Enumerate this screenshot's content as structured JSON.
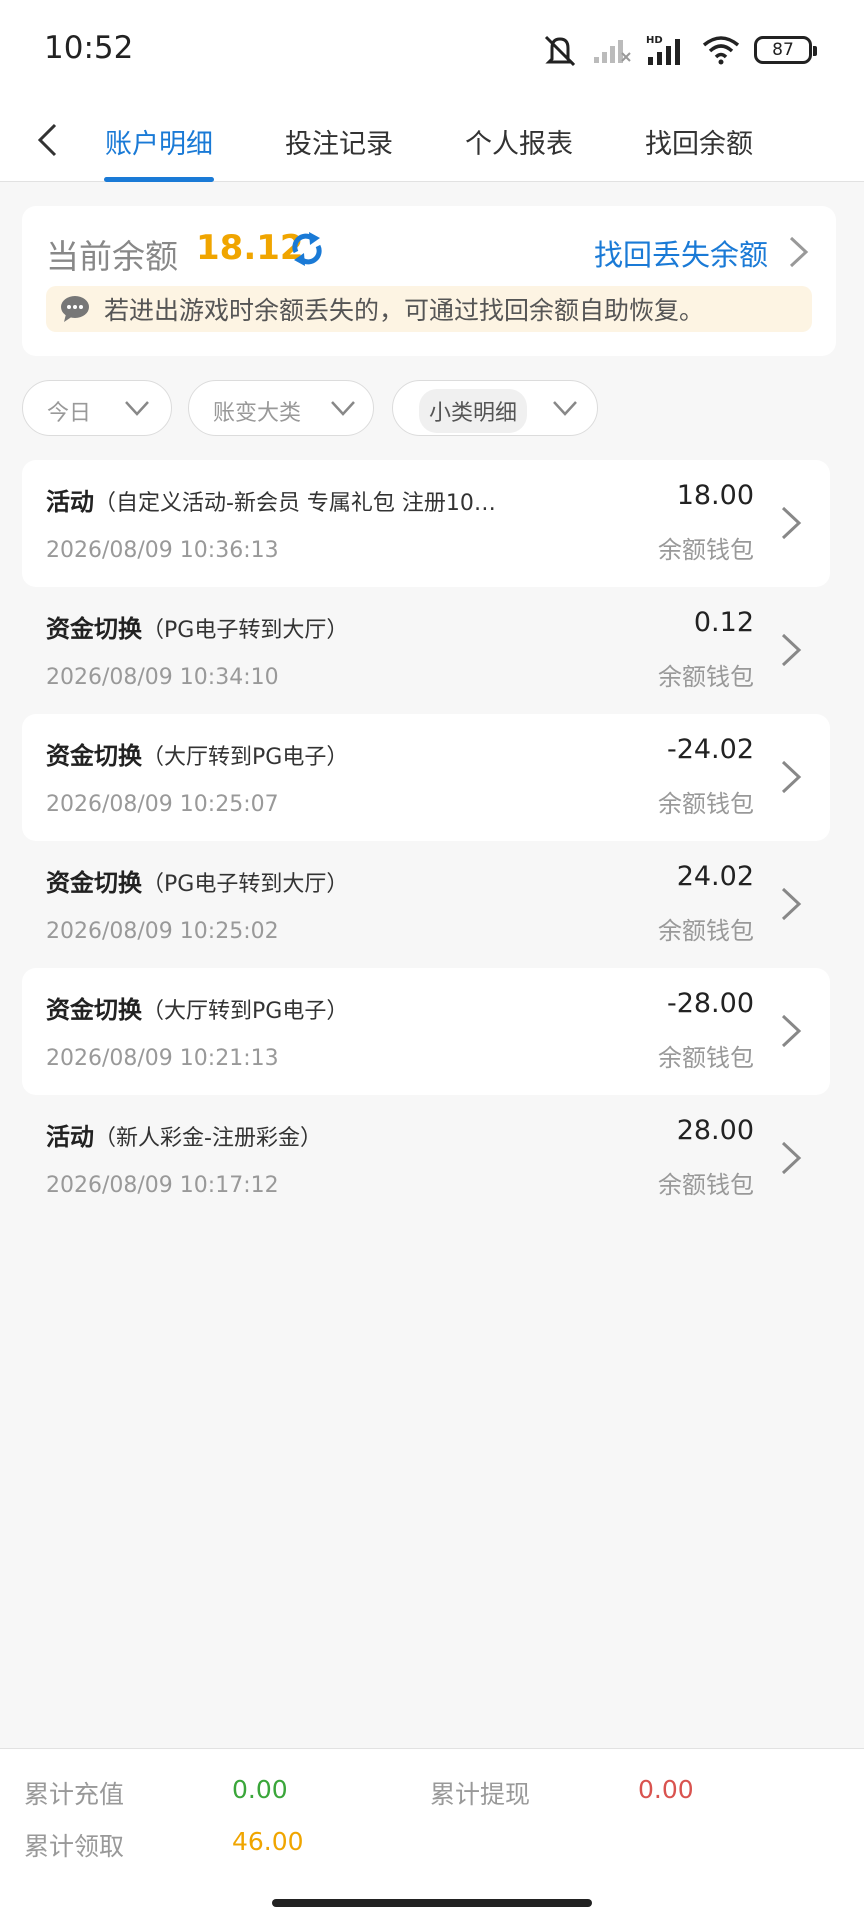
{
  "status_bar": {
    "time": "10:52",
    "battery": "87",
    "network": "HD",
    "icons": [
      "mute-icon",
      "signal-off-icon",
      "signal-hd-icon",
      "wifi-icon",
      "battery-icon"
    ]
  },
  "nav": {
    "tabs": [
      {
        "label": "账户明细",
        "active": true
      },
      {
        "label": "投注记录",
        "active": false
      },
      {
        "label": "个人报表",
        "active": false
      },
      {
        "label": "找回余额",
        "active": false
      }
    ],
    "accent": "#1a7ad6"
  },
  "balance": {
    "label": "当前余额",
    "value": "18.12",
    "recover_link": "找回丢失余额",
    "tip": "若进出游戏时余额丢失的，可通过找回余额自助恢复。"
  },
  "filters": [
    {
      "label": "今日"
    },
    {
      "label": "账变大类"
    },
    {
      "label": "小类明细"
    }
  ],
  "records": [
    {
      "type": "活动",
      "detail": "（自定义活动-新会员 专属礼包 注册10…",
      "time": "2026/08/09 10:36:13",
      "amount": "18.00",
      "wallet": "余额钱包"
    },
    {
      "type": "资金切换",
      "detail": "（PG电子转到大厅）",
      "time": "2026/08/09 10:34:10",
      "amount": "0.12",
      "wallet": "余额钱包"
    },
    {
      "type": "资金切换",
      "detail": "（大厅转到PG电子）",
      "time": "2026/08/09 10:25:07",
      "amount": "-24.02",
      "wallet": "余额钱包"
    },
    {
      "type": "资金切换",
      "detail": "（PG电子转到大厅）",
      "time": "2026/08/09 10:25:02",
      "amount": "24.02",
      "wallet": "余额钱包"
    },
    {
      "type": "资金切换",
      "detail": "（大厅转到PG电子）",
      "time": "2026/08/09 10:21:13",
      "amount": "-28.00",
      "wallet": "余额钱包"
    },
    {
      "type": "活动",
      "detail": "（新人彩金-注册彩金）",
      "time": "2026/08/09 10:17:12",
      "amount": "28.00",
      "wallet": "余额钱包"
    }
  ],
  "summary": {
    "recharge_label": "累计充值",
    "recharge_value": "0.00",
    "withdraw_label": "累计提现",
    "withdraw_value": "0.00",
    "claim_label": "累计领取",
    "claim_value": "46.00"
  }
}
